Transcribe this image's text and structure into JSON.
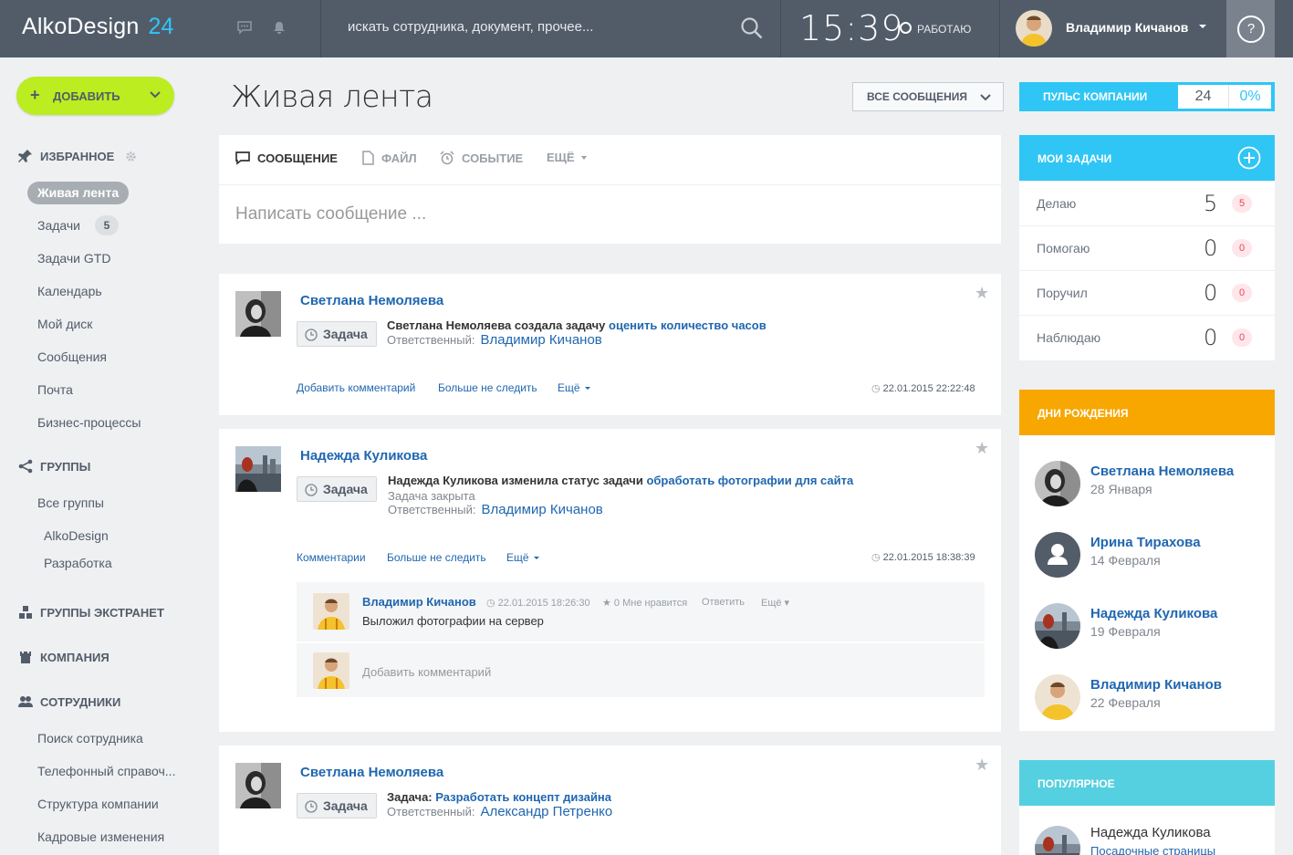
{
  "header": {
    "logo_main": "AlkoDesign",
    "logo_num": "24",
    "search_placeholder": "искать сотрудника, документ, прочее...",
    "clock": "15:39",
    "status": "РАБОТАЮ",
    "user_name": "Владимир Кичанов",
    "help": "?"
  },
  "sidebar": {
    "add_label": "ДОБАВИТЬ",
    "favorites": "ИЗБРАННОЕ",
    "items": [
      {
        "label": "Живая лента"
      },
      {
        "label": "Задачи",
        "badge": "5"
      },
      {
        "label": "Задачи GTD"
      },
      {
        "label": "Календарь"
      },
      {
        "label": "Мой диск"
      },
      {
        "label": "Сообщения"
      },
      {
        "label": "Почта"
      },
      {
        "label": "Бизнес-процессы"
      }
    ],
    "groups": "ГРУППЫ",
    "group_items": [
      "Все группы",
      "AlkoDesign",
      "Разработка"
    ],
    "extranet": "ГРУППЫ ЭКСТРАНЕТ",
    "company": "КОМПАНИЯ",
    "employees": "СОТРУДНИКИ",
    "employee_items": [
      "Поиск сотрудника",
      "Телефонный справоч...",
      "Структура компании",
      "Кадровые изменения"
    ]
  },
  "main": {
    "title": "Живая лента",
    "filter": "ВСЕ СООБЩЕНИЯ",
    "composer": {
      "tabs": [
        "СООБЩЕНИЕ",
        "ФАЙЛ",
        "СОБЫТИЕ",
        "ЕЩЁ"
      ],
      "placeholder": "Написать сообщение ..."
    },
    "task_label": "Задача",
    "responsible_label": "Ответственный:",
    "posts": [
      {
        "author": "Светлана Немоляева",
        "text": "Светлана Немоляева создала задачу",
        "task": "оценить количество часов",
        "responsible": "Владимир Кичанов",
        "actions": [
          "Добавить комментарий",
          "Больше не следить",
          "Ещё"
        ],
        "date": "22.01.2015 22:22:48"
      },
      {
        "author": "Надежда Куликова",
        "text": "Надежда Куликова  изменила статус задачи",
        "task": "обработать фотографии для сайта",
        "status": "Задача закрыта",
        "responsible": "Владимир Кичанов",
        "actions": [
          "Комментарии",
          "Больше не следить",
          "Ещё"
        ],
        "date": "22.01.2015 18:38:39",
        "comment": {
          "author": "Владимир Кичанов",
          "date": "◷ 22.01.2015 18:26:30",
          "likes": "★ 0 Мне нравится",
          "reply": "Ответить",
          "more": "Ещё ▾",
          "text": "Выложил фотографии на сервер"
        },
        "add_comment": "Добавить комментарий"
      },
      {
        "author": "Светлана Немоляева",
        "prefix": "Задача:",
        "task": "Разработать концепт дизайна",
        "responsible": "Александр Петренко"
      }
    ]
  },
  "right": {
    "pulse_label": "ПУЛЬС КОМПАНИИ",
    "pulse_count": "24",
    "pulse_percent": "0%",
    "tasks_title": "МОИ ЗАДАЧИ",
    "tasks": [
      {
        "label": "Делаю",
        "num": "5",
        "count": "5"
      },
      {
        "label": "Помогаю",
        "num": "0",
        "count": "0"
      },
      {
        "label": "Поручил",
        "num": "0",
        "count": "0"
      },
      {
        "label": "Наблюдаю",
        "num": "0",
        "count": "0"
      }
    ],
    "birthdays_title": "ДНИ РОЖДЕНИЯ",
    "birthdays": [
      {
        "name": "Светлана Немоляева",
        "date": "28 Января"
      },
      {
        "name": "Ирина Тирахова",
        "date": "14 Февраля"
      },
      {
        "name": "Надежда Куликова",
        "date": "19 Февраля"
      },
      {
        "name": "Владимир Кичанов",
        "date": "22 Февраля"
      }
    ],
    "popular_title": "ПОПУЛЯРНОЕ",
    "popular": {
      "name": "Надежда Куликова",
      "sub": "Посадочные страницы"
    }
  },
  "colors": {
    "topbar": "#525c69",
    "accent_blue": "#2fc6f6",
    "add_green": "#bbed21",
    "birthday_orange": "#f7a700",
    "popular_teal": "#55d0e0",
    "link": "#2067b0"
  }
}
